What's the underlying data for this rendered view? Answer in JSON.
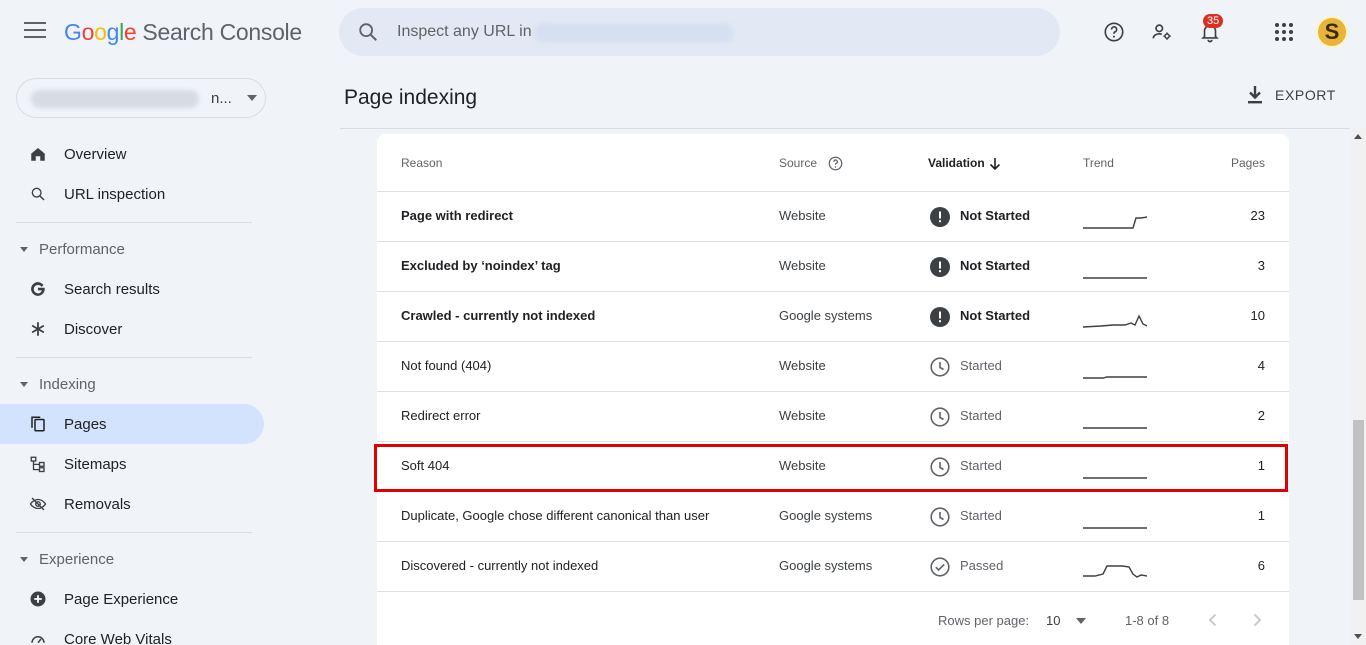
{
  "app": {
    "logo_letters": [
      "G",
      "o",
      "o",
      "g",
      "l",
      "e"
    ],
    "logo_rest": "Search Console"
  },
  "search": {
    "placeholder": "Inspect any URL in"
  },
  "header": {
    "notification_count": "35",
    "avatar_letter": "S"
  },
  "property": {
    "tail": "n..."
  },
  "sidebar": {
    "items": {
      "overview": "Overview",
      "url_inspection": "URL inspection",
      "search_results": "Search results",
      "discover": "Discover",
      "pages": "Pages",
      "sitemaps": "Sitemaps",
      "removals": "Removals",
      "page_experience": "Page Experience",
      "core_web_vitals": "Core Web Vitals"
    },
    "sections": {
      "performance": "Performance",
      "indexing": "Indexing",
      "experience": "Experience"
    }
  },
  "main": {
    "title": "Page indexing",
    "export_label": "EXPORT"
  },
  "table": {
    "headers": {
      "reason": "Reason",
      "source": "Source",
      "validation": "Validation",
      "trend": "Trend",
      "pages": "Pages"
    },
    "rows": [
      {
        "reason": "Page with redirect",
        "source": "Website",
        "validation": "Not Started",
        "pages": "23"
      },
      {
        "reason": "Excluded by ‘noindex’ tag",
        "source": "Website",
        "validation": "Not Started",
        "pages": "3"
      },
      {
        "reason": "Crawled - currently not indexed",
        "source": "Google systems",
        "validation": "Not Started",
        "pages": "10"
      },
      {
        "reason": "Not found (404)",
        "source": "Website",
        "validation": "Started",
        "pages": "4"
      },
      {
        "reason": "Redirect error",
        "source": "Website",
        "validation": "Started",
        "pages": "2"
      },
      {
        "reason": "Soft 404",
        "source": "Website",
        "validation": "Started",
        "pages": "1"
      },
      {
        "reason": "Duplicate, Google chose different canonical than user",
        "source": "Google systems",
        "validation": "Started",
        "pages": "1"
      },
      {
        "reason": "Discovered - currently not indexed",
        "source": "Google systems",
        "validation": "Passed",
        "pages": "6"
      }
    ],
    "footer": {
      "rows_per_page_label": "Rows per page:",
      "rows_per_page_value": "10",
      "range": "1-8 of 8"
    }
  },
  "colors": {
    "accent": "#1a73e8",
    "active_nav": "#d3e3fd",
    "highlight": "#e00000",
    "badge": "#d93025"
  }
}
